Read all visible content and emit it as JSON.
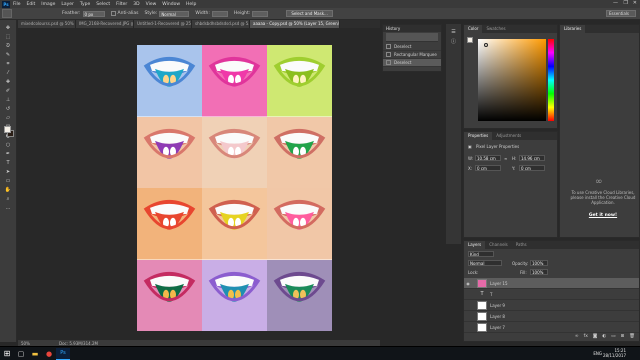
{
  "menubar": {
    "logo": "Ps",
    "items": [
      "File",
      "Edit",
      "Image",
      "Layer",
      "Type",
      "Select",
      "Filter",
      "3D",
      "View",
      "Window",
      "Help"
    ],
    "window_controls": [
      "—",
      "❐",
      "✕"
    ]
  },
  "options": {
    "feather_label": "Feather:",
    "feather_value": "0 px",
    "antialias_label": "Anti-alias",
    "style_label": "Style:",
    "style_value": "Normal",
    "width_label": "Width:",
    "height_label": "Height:",
    "select_mask_label": "Select and Mask...",
    "workspace": "Essentials"
  },
  "tabs": [
    {
      "label": "mixedcolourss.psd @ 50% ...",
      "active": false
    },
    {
      "label": "IMG_2168-Recovered.JPG @...",
      "active": false
    },
    {
      "label": "Untitled-1-Recovered @ 25...",
      "active": false
    },
    {
      "label": "shbdsbdhsbdsdsd.psd @ 5...",
      "active": false
    },
    {
      "label": "aaaaa - Copy.psd @ 50% (Layer 15, Green/8) *",
      "active": true
    }
  ],
  "statusbar": {
    "zoom": "50%",
    "doc": "Doc: 5.93M/314.2M"
  },
  "history": {
    "title": "History",
    "items": [
      "Deselect",
      "Rectangular Marquee",
      "Deselect"
    ],
    "selected_index": 2
  },
  "color_panel": {
    "tabs": [
      "Color",
      "Swatches"
    ],
    "active_tab": 0,
    "hue_color": "#ff9a00"
  },
  "properties": {
    "tabs": [
      "Properties",
      "Adjustments"
    ],
    "title": "Pixel Layer Properties",
    "w_label": "W:",
    "w_value": "10.58 cm",
    "h_label": "H:",
    "h_value": "14.96 cm",
    "x_label": "X:",
    "x_value": "0 cm",
    "y_label": "Y:",
    "y_value": "0 cm",
    "go_label": "GO"
  },
  "libraries": {
    "title": "Libraries",
    "message": "To use Creative Cloud Libraries, please install the Creative Cloud Application.",
    "link": "Get it now!"
  },
  "layers": {
    "tabs": [
      "Layers",
      "Channels",
      "Paths"
    ],
    "kind_label": "Kind",
    "blend_mode": "Normal",
    "opacity_label": "Opacity:",
    "opacity_value": "100%",
    "lock_label": "Lock:",
    "fill_label": "Fill:",
    "fill_value": "100%",
    "rows": [
      {
        "name": "Layer 15",
        "type": "pixel",
        "selected": true
      },
      {
        "name": "T",
        "type": "text",
        "selected": false
      },
      {
        "name": "Layer 9",
        "type": "pixel",
        "selected": false
      },
      {
        "name": "Layer 8",
        "type": "pixel",
        "selected": false
      },
      {
        "name": "Layer 7",
        "type": "pixel",
        "selected": false
      }
    ],
    "footer_icons": [
      "link-icon",
      "fx-icon",
      "mask-icon",
      "adjustment-icon",
      "folder-icon",
      "new-layer-icon",
      "trash-icon"
    ]
  },
  "tiles": [
    {
      "bg": "#a9c4ec",
      "lip": "#4b86d4",
      "tongue": "#1ea7c8",
      "tip": "#ffd48a"
    },
    {
      "bg": "#f26fb5",
      "lip": "#e0349b",
      "tongue": "#f039a9",
      "tip": "#ffffff"
    },
    {
      "bg": "#cfe872",
      "lip": "#9fce2f",
      "tongue": "#8cbf1f",
      "tip": "#fff4c0"
    },
    {
      "bg": "#f2c5a5",
      "lip": "#d9776b",
      "tongue": "#8f3bb4",
      "tip": "#ffffff"
    },
    {
      "bg": "#f0d1b6",
      "lip": "#d8877a",
      "tongue": "#f4c9cc",
      "tip": "#ffffff"
    },
    {
      "bg": "#f1c8a8",
      "lip": "#cf6f64",
      "tongue": "#22a34a",
      "tip": "#ffffff"
    },
    {
      "bg": "#f2b37b",
      "lip": "#e8462f",
      "tongue": "#e8462f",
      "tip": "#ffffff"
    },
    {
      "bg": "#f4c69c",
      "lip": "#d0604f",
      "tongue": "#e6d321",
      "tip": "#ffffff"
    },
    {
      "bg": "#f1c7a7",
      "lip": "#d36b60",
      "tongue": "#ff5d9e",
      "tip": "#ffffff"
    },
    {
      "bg": "#e48ab6",
      "lip": "#c42b61",
      "tongue": "#0e6b45",
      "tip": "#f5b84a"
    },
    {
      "bg": "#c9aee6",
      "lip": "#8b5dcf",
      "tongue": "#1f8fb1",
      "tip": "#f1c04a"
    },
    {
      "bg": "#9f8fb8",
      "lip": "#6d4a8f",
      "tongue": "#1a8a5a",
      "tip": "#f0c15a"
    }
  ],
  "taskbar": {
    "start": "⊞",
    "lang": "ENG",
    "time": "15:21",
    "date": "28/11/2017"
  }
}
